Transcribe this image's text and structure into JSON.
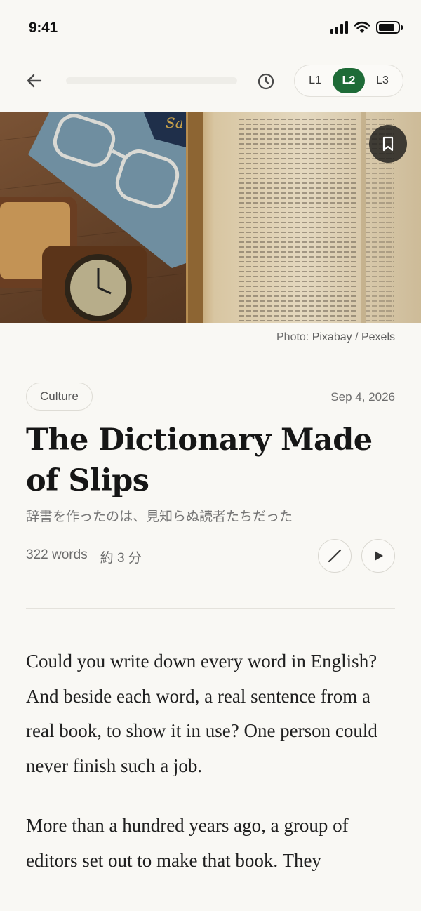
{
  "status_bar": {
    "time": "9:41",
    "battery_level": 0.85
  },
  "nav": {
    "reading_progress": 0.0,
    "levels": [
      "L1",
      "L2",
      "L3"
    ],
    "active_level": "L2"
  },
  "photo_credit": {
    "prefix": "Photo: ",
    "author": "Pixabay",
    "separator": " / ",
    "source": "Pexels"
  },
  "article": {
    "category": "Culture",
    "date": "Sep 4, 2026",
    "title": "The Dictionary Made of Slips",
    "subtitle": "辞書を作ったのは、見知らぬ読者たちだった",
    "word_count": "322 words",
    "read_time": "約 3 分",
    "paragraphs": [
      "Could you write down every word in English? And beside each word, a real sentence from a real book, to show it in use? One person could never finish such a job.",
      "More than a hundred years ago, a group of editors set out to make that book. They"
    ]
  },
  "colors": {
    "accent": "#1e6b37",
    "background": "#f9f8f4"
  },
  "icons": [
    "back-arrow-icon",
    "history-clock-icon",
    "bookmark-icon",
    "pen-icon",
    "play-icon"
  ]
}
